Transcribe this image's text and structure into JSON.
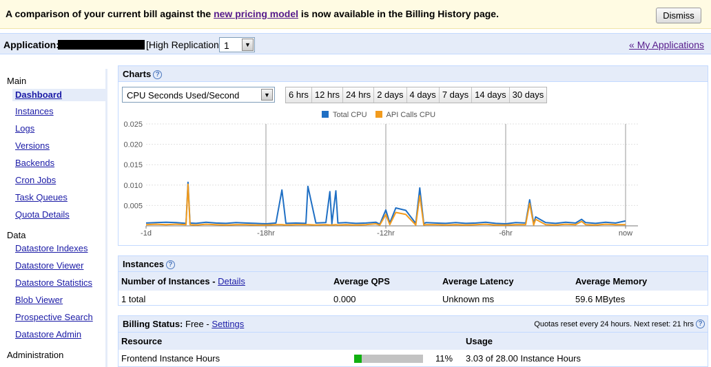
{
  "banner": {
    "text_before": "A comparison of your current bill against the",
    "link": "new pricing model",
    "text_after": "is now available in the Billing History page.",
    "dismiss_label": "Dismiss"
  },
  "appbar": {
    "label": "Application:",
    "replication": "[High Replication]",
    "version_value": "1",
    "my_apps_link": "« My Applications"
  },
  "nav": {
    "sections": [
      {
        "title": "Main",
        "items": [
          "Dashboard",
          "Instances",
          "Logs",
          "Versions",
          "Backends",
          "Cron Jobs",
          "Task Queues",
          "Quota Details"
        ]
      },
      {
        "title": "Data",
        "items": [
          "Datastore Indexes",
          "Datastore Viewer",
          "Datastore Statistics",
          "Blob Viewer",
          "Prospective Search",
          "Datastore Admin"
        ]
      },
      {
        "title": "Administration",
        "items": []
      }
    ],
    "active": "Dashboard"
  },
  "charts": {
    "title": "Charts",
    "metric": "CPU Seconds Used/Second",
    "ranges": [
      "6 hrs",
      "12 hrs",
      "24 hrs",
      "2 days",
      "4 days",
      "7 days",
      "14 days",
      "30 days"
    ]
  },
  "chart_data": {
    "type": "line",
    "title": "",
    "xlabel": "",
    "ylabel": "",
    "x_ticks": [
      "-1d",
      "-18hr",
      "-12hr",
      "-6hr",
      "now"
    ],
    "x_range_hours": [
      -24,
      0
    ],
    "y_ticks": [
      "0.025",
      "0.020",
      "0.015",
      "0.010",
      "0.005"
    ],
    "ylim": [
      0,
      0.025
    ],
    "legend_position": "top",
    "grid": true,
    "series": [
      {
        "name": "Total CPU",
        "color": "#1f6fc4",
        "x": [
          -24,
          -23.5,
          -23,
          -22.5,
          -22,
          -21.9,
          -21.8,
          -21.5,
          -21,
          -20.5,
          -20,
          -19.5,
          -19,
          -18.5,
          -18,
          -17.5,
          -17.2,
          -17,
          -16.5,
          -16,
          -15.9,
          -15.5,
          -15,
          -14.8,
          -14.7,
          -14.5,
          -14.4,
          -14,
          -13.5,
          -13,
          -12.5,
          -12.3,
          -12,
          -11.8,
          -11.5,
          -11,
          -10.5,
          -10.3,
          -10.1,
          -10,
          -9.5,
          -9,
          -8.5,
          -8,
          -7.5,
          -7,
          -6.5,
          -6,
          -5.5,
          -5,
          -4.8,
          -4.6,
          -4.5,
          -4,
          -3.5,
          -3,
          -2.5,
          -2.2,
          -2,
          -1.5,
          -1,
          -0.5,
          0
        ],
        "values": [
          0.0007,
          0.0008,
          0.0009,
          0.0008,
          0.0006,
          0.0107,
          0.0007,
          0.0006,
          0.0009,
          0.0007,
          0.0006,
          0.0008,
          0.0007,
          0.0006,
          0.0005,
          0.0007,
          0.0088,
          0.0006,
          0.0007,
          0.0006,
          0.0097,
          0.0007,
          0.0008,
          0.0084,
          0.0005,
          0.0086,
          0.0007,
          0.0008,
          0.0006,
          0.0007,
          0.0009,
          0.0004,
          0.0039,
          0.0007,
          0.0044,
          0.0038,
          0.0006,
          0.0093,
          0.0005,
          0.0008,
          0.0007,
          0.0006,
          0.0008,
          0.0006,
          0.0007,
          0.0009,
          0.0006,
          0.0005,
          0.0008,
          0.0007,
          0.0064,
          0.0006,
          0.0022,
          0.0008,
          0.0006,
          0.0009,
          0.0007,
          0.0016,
          0.0008,
          0.0006,
          0.0009,
          0.0007,
          0.0012
        ]
      },
      {
        "name": "API Calls CPU",
        "color": "#f29b1d",
        "x": [
          -24,
          -23.5,
          -23,
          -22.5,
          -22,
          -21.9,
          -21.8,
          -21.5,
          -21,
          -20.5,
          -20,
          -19.5,
          -19,
          -18.5,
          -18,
          -17.5,
          -17.2,
          -17,
          -16.5,
          -16,
          -15.9,
          -15.5,
          -15,
          -14.8,
          -14.7,
          -14.5,
          -14.4,
          -14,
          -13.5,
          -13,
          -12.5,
          -12.3,
          -12,
          -11.8,
          -11.5,
          -11,
          -10.5,
          -10.3,
          -10.1,
          -10,
          -9.5,
          -9,
          -8.5,
          -8,
          -7.5,
          -7,
          -6.5,
          -6,
          -5.5,
          -5,
          -4.8,
          -4.6,
          -4.5,
          -4,
          -3.5,
          -3,
          -2.5,
          -2.2,
          -2,
          -1.5,
          -1,
          -0.5,
          0
        ],
        "values": [
          0.0003,
          0.0004,
          0.0003,
          0.0004,
          0.0003,
          0.0102,
          0.0003,
          0.0002,
          0.0004,
          0.0003,
          0.0002,
          0.0003,
          0.0003,
          0.0002,
          0.0002,
          0.0003,
          0.0003,
          0.0002,
          0.0003,
          0.0003,
          0.0003,
          0.0002,
          0.0003,
          0.0002,
          0.0002,
          0.0003,
          0.0002,
          0.0003,
          0.0002,
          0.0003,
          0.0005,
          0.0002,
          0.0028,
          0.0003,
          0.0033,
          0.0028,
          0.0002,
          0.0074,
          0.0002,
          0.0003,
          0.0003,
          0.0002,
          0.0003,
          0.0002,
          0.0003,
          0.0004,
          0.0002,
          0.0002,
          0.0003,
          0.0003,
          0.0055,
          0.0002,
          0.0016,
          0.0003,
          0.0002,
          0.0004,
          0.0003,
          0.0011,
          0.0003,
          0.0002,
          0.0004,
          0.0003,
          0.0003
        ]
      }
    ]
  },
  "instances": {
    "title": "Instances",
    "headers": [
      "Number of Instances",
      "Average QPS",
      "Average Latency",
      "Average Memory"
    ],
    "details_link": "Details",
    "row": [
      "1 total",
      "0.000",
      "Unknown ms",
      "59.6 MBytes"
    ]
  },
  "billing": {
    "label": "Billing Status:",
    "status": "Free -",
    "settings_link": "Settings",
    "quota_note": "Quotas reset every 24 hours. Next reset: 21 hrs",
    "headers": [
      "Resource",
      "Usage"
    ],
    "rows": [
      {
        "resource": "Frontend Instance Hours",
        "percent_label": "11%",
        "percent": 11,
        "usage": "3.03 of 28.00 Instance Hours"
      }
    ]
  }
}
